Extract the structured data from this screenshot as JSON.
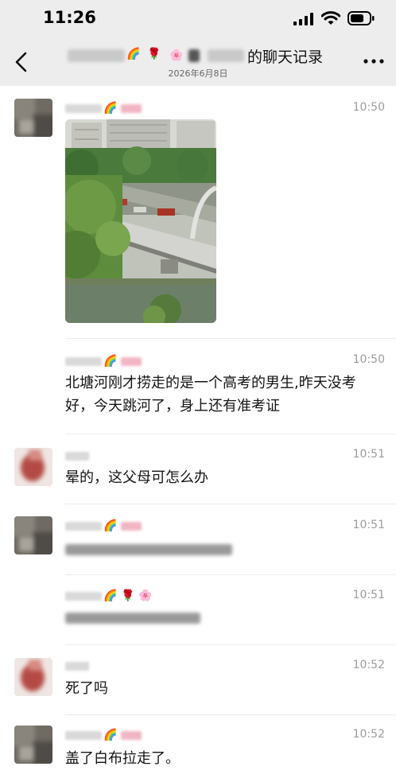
{
  "status": {
    "time": "11:26"
  },
  "header": {
    "title": "的聊天记录",
    "date": "2026年6月8日"
  },
  "messages": [
    {
      "time": "10:50",
      "kind": "image",
      "image_alt": "河道与桥梁照片"
    },
    {
      "time": "10:50",
      "kind": "text",
      "text": "北塘河刚才捞走的是一个高考的男生,昨天没考好，今天跳河了，身上还有准考证"
    },
    {
      "time": "10:51",
      "kind": "text",
      "text": "晕的，这父母可怎么办"
    },
    {
      "time": "10:51",
      "kind": "blurred"
    },
    {
      "time": "10:51",
      "kind": "blurred"
    },
    {
      "time": "10:52",
      "kind": "text",
      "text": "死了吗"
    },
    {
      "time": "10:52",
      "kind": "text",
      "text": "盖了白布拉走了。"
    }
  ],
  "icons": {
    "back": "chevron-left-icon",
    "more": "more-dots-icon",
    "signal": "signal-icon",
    "wifi": "wifi-icon",
    "battery": "battery-icon"
  },
  "colors": {
    "bar_bg": "#ededed",
    "timestamp": "#9c9c9c",
    "text": "#141414"
  }
}
